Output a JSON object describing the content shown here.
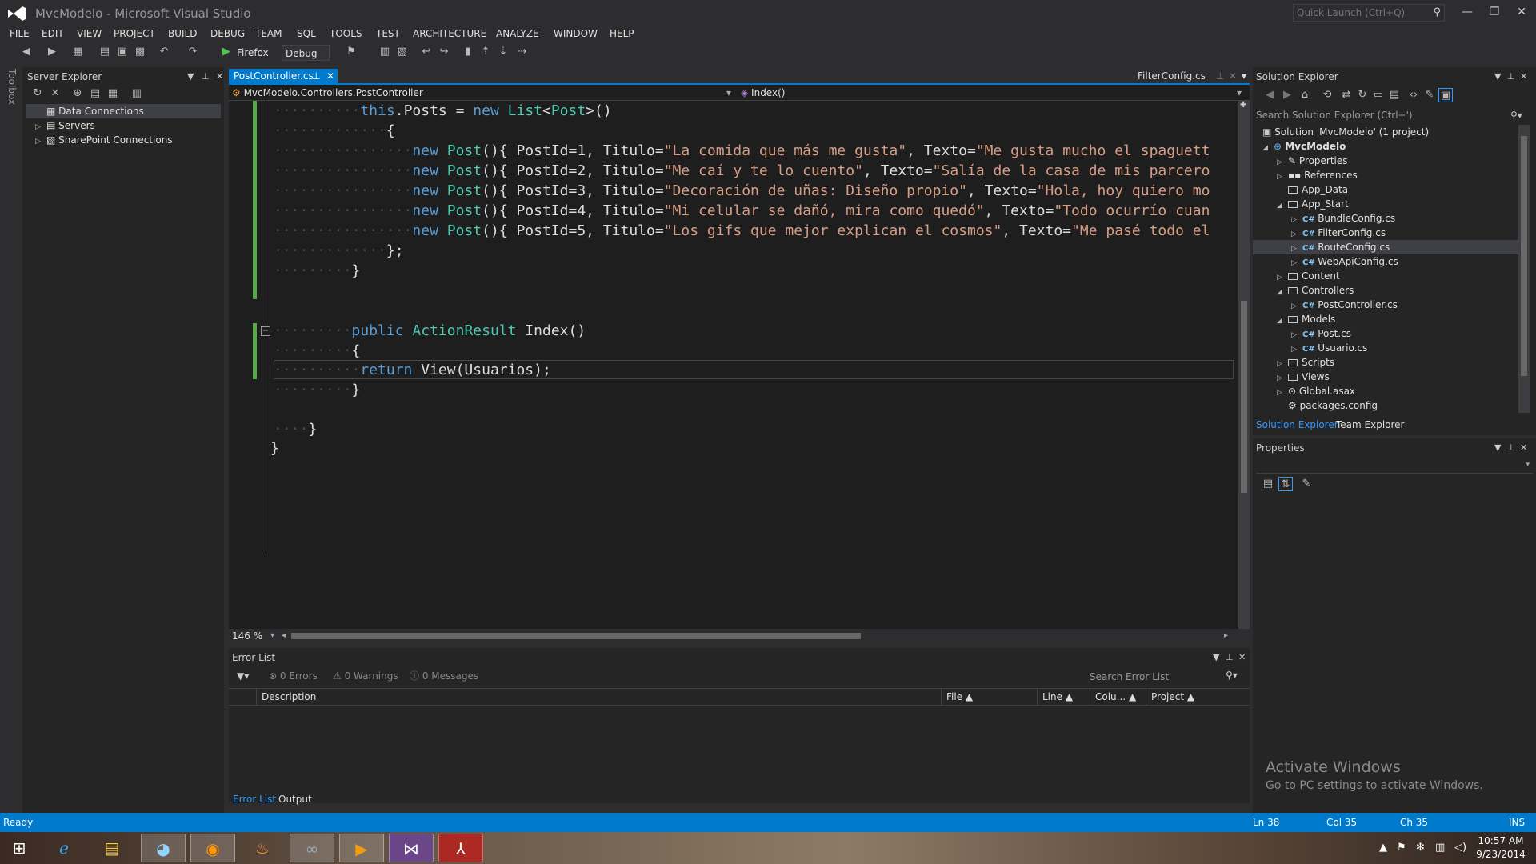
{
  "window": {
    "title": "MvcModelo - Microsoft Visual Studio",
    "quick_launch_placeholder": "Quick Launch (Ctrl+Q)"
  },
  "menu": [
    "FILE",
    "EDIT",
    "VIEW",
    "PROJECT",
    "BUILD",
    "DEBUG",
    "TEAM",
    "SQL",
    "TOOLS",
    "TEST",
    "ARCHITECTURE",
    "ANALYZE",
    "WINDOW",
    "HELP"
  ],
  "toolbar": {
    "run_target": "Firefox",
    "configuration": "Debug"
  },
  "toolbox_label": "Toolbox",
  "server_explorer": {
    "title": "Server Explorer",
    "items": [
      "Data Connections",
      "Servers",
      "SharePoint Connections"
    ]
  },
  "editor": {
    "active_tab": "PostController.cs",
    "right_tab": "FilterConfig.cs",
    "nav_class": "MvcModelo.Controllers.PostController",
    "nav_member": "Index()",
    "zoom": "146 %",
    "code": {
      "l1_this": "this",
      "l1_posts": ".Posts = ",
      "l1_new": "new",
      "l1_list": "List",
      "l1_post": "Post",
      "l1_end": ">()",
      "brace_open": "{",
      "new_kw": "new",
      "post_kw": "Post",
      "post_rows": [
        {
          "id": "(){ PostId=1, Titulo=",
          "titulo": "\"La comida que más me gusta\"",
          "texto_lbl": ", Texto=",
          "texto": "\"Me gusta mucho el spaguett"
        },
        {
          "id": "(){ PostId=2, Titulo=",
          "titulo": "\"Me caí y te lo cuento\"",
          "texto_lbl": ", Texto=",
          "texto": "\"Salía de la casa de mis parcero"
        },
        {
          "id": "(){ PostId=3, Titulo=",
          "titulo": "\"Decoración de uñas: Diseño propio\"",
          "texto_lbl": ", Texto=",
          "texto": "\"Hola, hoy quiero mo"
        },
        {
          "id": "(){ PostId=4, Titulo=",
          "titulo": "\"Mi celular se dañó, mira como quedó\"",
          "texto_lbl": ", Texto=",
          "texto": "\"Todo ocurrío cuan"
        },
        {
          "id": "(){ PostId=5, Titulo=",
          "titulo": "\"Los gifs que mejor explican el cosmos\"",
          "texto_lbl": ", Texto=",
          "texto": "\"Me pasé todo el"
        }
      ],
      "close_list": "};",
      "close_brace": "}",
      "public_kw": "public",
      "action_result": "ActionResult",
      "index_sig": " Index()",
      "return_kw": "return",
      "return_expr": " View(Usuarios);"
    }
  },
  "error_list": {
    "title": "Error List",
    "errors": "0 Errors",
    "warnings": "0 Warnings",
    "messages": "0 Messages",
    "search_placeholder": "Search Error List",
    "columns": [
      "Description",
      "File",
      "Line",
      "Colu...",
      "Project"
    ],
    "tabs": [
      "Error List",
      "Output"
    ]
  },
  "solution_explorer": {
    "title": "Solution Explorer",
    "search_placeholder": "Search Solution Explorer (Ctrl+')",
    "items": [
      {
        "label": "Solution 'MvcModelo' (1 project)"
      },
      {
        "label": "MvcModelo"
      },
      {
        "label": "Properties"
      },
      {
        "label": "References"
      },
      {
        "label": "App_Data"
      },
      {
        "label": "App_Start"
      },
      {
        "label": "BundleConfig.cs"
      },
      {
        "label": "FilterConfig.cs"
      },
      {
        "label": "RouteConfig.cs"
      },
      {
        "label": "WebApiConfig.cs"
      },
      {
        "label": "Content"
      },
      {
        "label": "Controllers"
      },
      {
        "label": "PostController.cs"
      },
      {
        "label": "Models"
      },
      {
        "label": "Post.cs"
      },
      {
        "label": "Usuario.cs"
      },
      {
        "label": "Scripts"
      },
      {
        "label": "Views"
      },
      {
        "label": "Global.asax"
      },
      {
        "label": "packages.config"
      }
    ],
    "tabs": [
      "Solution Explorer",
      "Team Explorer"
    ]
  },
  "properties": {
    "title": "Properties"
  },
  "watermark": {
    "line1": "Activate Windows",
    "line2": "Go to PC settings to activate Windows."
  },
  "status": {
    "ready": "Ready",
    "ln": "Ln 38",
    "col": "Col 35",
    "ch": "Ch 35",
    "mode": "INS"
  },
  "clock": {
    "time": "10:57 AM",
    "date": "9/23/2014"
  },
  "colors": {
    "accent": "#007acc",
    "keyword": "#569cd6",
    "type": "#4ec9b0",
    "string": "#d69d85"
  }
}
